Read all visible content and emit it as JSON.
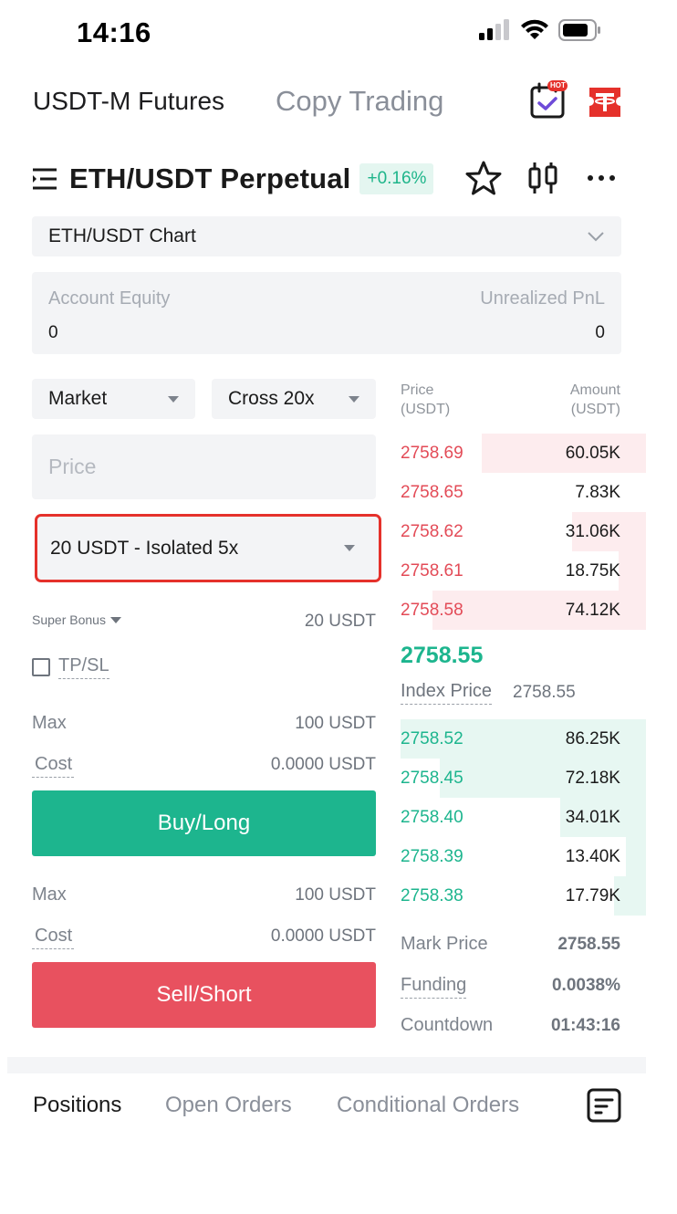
{
  "status": {
    "time": "14:16"
  },
  "header": {
    "tab_futures": "USDT-M Futures",
    "tab_copy": "Copy Trading",
    "hot_badge": "HOT",
    "calendar_icon": "calendar-check-icon",
    "brand_icon": "tether-icon"
  },
  "pair": {
    "name": "ETH/USDT Perpetual",
    "change": "+0.16%",
    "menu_icon": "list-menu-icon",
    "star_icon": "star-icon",
    "candle_icon": "candlestick-icon",
    "more_icon": "more-icon"
  },
  "chart_selector": {
    "label": "ETH/USDT Chart"
  },
  "equity": {
    "account_label": "Account Equity",
    "account_value": "0",
    "pnl_label": "Unrealized PnL",
    "pnl_value": "0"
  },
  "order_form": {
    "order_type": "Market",
    "leverage": "Cross 20x",
    "price_placeholder": "Price",
    "bonus_select": "20 USDT - Isolated 5x",
    "super_bonus_label": "Super Bonus",
    "super_bonus_value": "20 USDT",
    "tpsl_label": "TP/SL",
    "buy": {
      "max_label": "Max",
      "max_value": "100 USDT",
      "cost_label": "Cost",
      "cost_value": "0.0000 USDT",
      "button": "Buy/Long"
    },
    "sell": {
      "max_label": "Max",
      "max_value": "100 USDT",
      "cost_label": "Cost",
      "cost_value": "0.0000 USDT",
      "button": "Sell/Short"
    }
  },
  "orderbook": {
    "price_header_1": "Price",
    "price_header_2": "(USDT)",
    "amount_header_1": "Amount",
    "amount_header_2": "(USDT)",
    "asks": [
      {
        "price": "2758.69",
        "amount": "60.05K",
        "depth": 0.67
      },
      {
        "price": "2758.65",
        "amount": "7.83K",
        "depth": 0.0
      },
      {
        "price": "2758.62",
        "amount": "31.06K",
        "depth": 0.3
      },
      {
        "price": "2758.61",
        "amount": "18.75K",
        "depth": 0.11
      },
      {
        "price": "2758.58",
        "amount": "74.12K",
        "depth": 0.87
      }
    ],
    "last_price": "2758.55",
    "index_label": "Index Price",
    "index_value": "2758.55",
    "bids": [
      {
        "price": "2758.52",
        "amount": "86.25K",
        "depth": 1.0
      },
      {
        "price": "2758.45",
        "amount": "72.18K",
        "depth": 0.84
      },
      {
        "price": "2758.40",
        "amount": "34.01K",
        "depth": 0.35
      },
      {
        "price": "2758.39",
        "amount": "13.40K",
        "depth": 0.08
      },
      {
        "price": "2758.38",
        "amount": "17.79K",
        "depth": 0.13
      }
    ]
  },
  "stats": {
    "mark_label": "Mark Price",
    "mark_value": "2758.55",
    "funding_label": "Funding",
    "funding_value": "0.0038%",
    "countdown_label": "Countdown",
    "countdown_value": "01:43:16"
  },
  "bottom_tabs": {
    "positions": "Positions",
    "open_orders": "Open Orders",
    "conditional_orders": "Conditional Orders",
    "records_icon": "document-icon"
  },
  "colors": {
    "green": "#1db58e",
    "red": "#e8515f",
    "highlight_border": "#e5312b"
  }
}
